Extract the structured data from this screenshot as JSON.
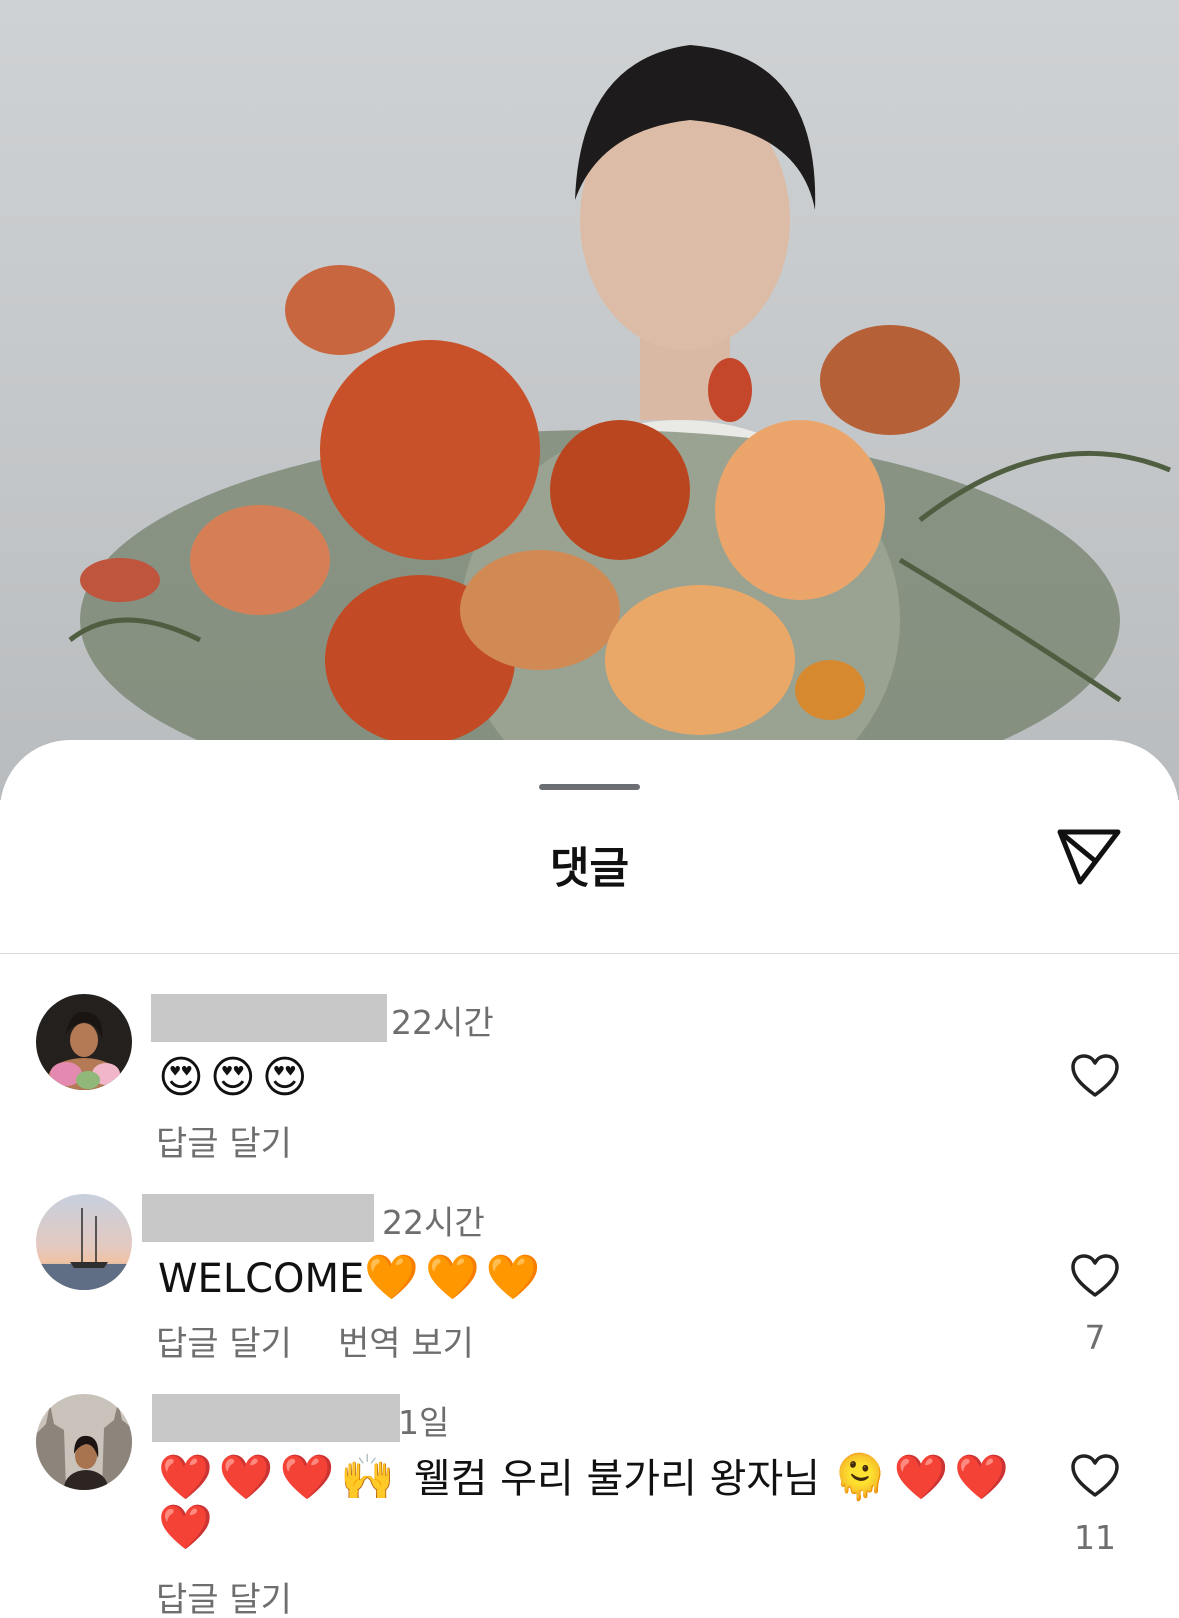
{
  "sheet": {
    "title": "댓글"
  },
  "comments": [
    {
      "time": "22시간",
      "text_emoji": "😍😍😍",
      "reply_label": "답글 달기",
      "like_count": ""
    },
    {
      "time": "22시간",
      "text": "WELCOME",
      "text_emoji": "🧡🧡🧡",
      "reply_label": "답글 달기",
      "translate_label": "번역 보기",
      "like_count": "7"
    },
    {
      "time": "1일",
      "text_line1_emoji_a": "❤️❤️❤️🙌",
      "text_line1": "웰컴 우리 불가리 왕자님",
      "text_line1_emoji_b": "🫠❤️❤️",
      "text_line2_emoji": "❤️",
      "reply_label": "답글 달기",
      "like_count": "11"
    }
  ],
  "icons": {
    "share": "paper-plane-icon",
    "like": "heart-outline-icon"
  },
  "colors": {
    "text_primary": "#111111",
    "text_secondary": "#6e6e6e",
    "username_redaction": "#c8c8c8"
  }
}
